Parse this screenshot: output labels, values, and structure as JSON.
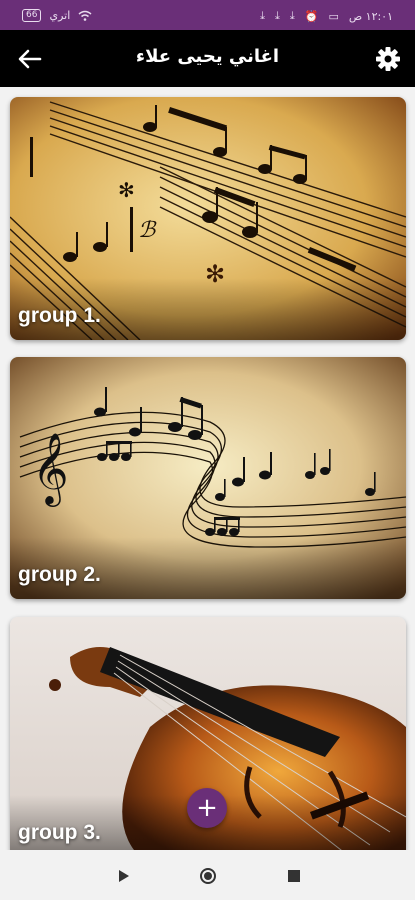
{
  "status_bar": {
    "battery": "66",
    "network": "اتري",
    "time": "١٢:٠١ ص"
  },
  "app_bar": {
    "title": "اغاني يحيى علاء",
    "back_icon": "arrow-left-icon",
    "settings_icon": "gear-icon"
  },
  "groups": [
    {
      "label": "group 1.",
      "image": "sheet-music"
    },
    {
      "label": "group 2.",
      "image": "music-notes-swirl"
    },
    {
      "label": "group 3.",
      "image": "violin"
    }
  ],
  "fab": {
    "icon": "plus-icon",
    "label": "+"
  },
  "nav_bar": {
    "icons": [
      "back-triangle-icon",
      "home-circle-icon",
      "recents-square-icon"
    ]
  },
  "colors": {
    "accent": "#6a2f78",
    "app_bar": "#000000"
  }
}
